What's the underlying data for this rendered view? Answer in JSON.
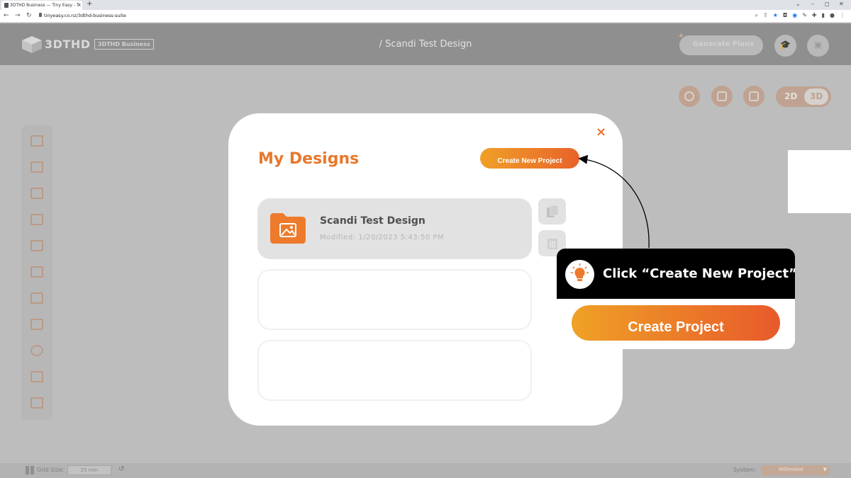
{
  "browser": {
    "tab_title": "3DTHD Business — Tiny Easy - T",
    "tab_close": "x",
    "new_tab": "+",
    "url": "tinyeasy.co.nz/3dthd-business-suite",
    "win_min": "–",
    "win_max": "◻",
    "win_close": "✕",
    "win_menu": "⌄"
  },
  "header": {
    "logo_text": "3DTHD",
    "logo_badge": "3DTHD Business",
    "doc_title": "/ Scandi Test Design",
    "generate_plans": "Generate Plans"
  },
  "view_toggle": {
    "label_2d": "2D",
    "label_3d": "3D"
  },
  "status_bar": {
    "grid_label": "Grid Size:",
    "grid_value": "25 mm",
    "system_label": "System:",
    "system_value": "Millimetre"
  },
  "modal": {
    "title": "My Designs",
    "close": "×",
    "create_new_label": "Create New Project",
    "designs": [
      {
        "name": "Scandi Test Design",
        "modified": "Modified: 1/20/2023 5:43:50 PM"
      }
    ]
  },
  "tooltip": {
    "text": "Click “Create New Project”",
    "button_label": "Create Project"
  },
  "colors": {
    "accent": "#e8782c",
    "accent_gradient_start": "#f0a027",
    "accent_gradient_end": "#e8622a"
  }
}
